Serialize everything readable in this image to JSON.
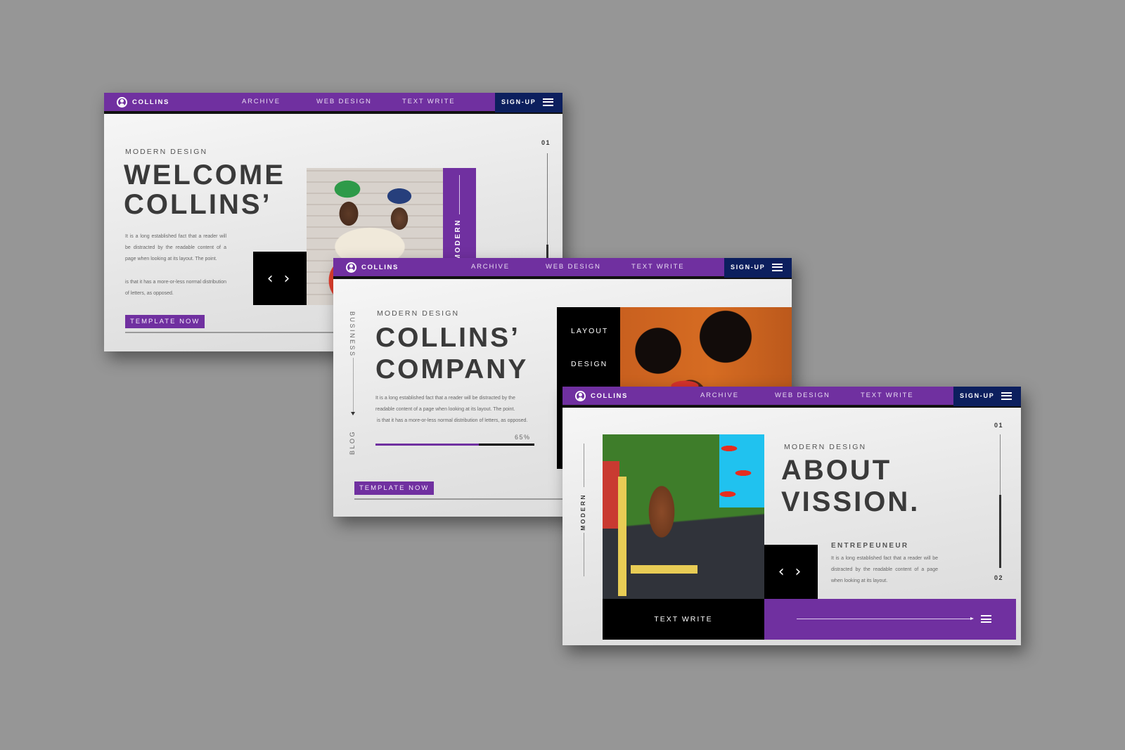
{
  "colors": {
    "brand_purple": "#7030a0",
    "signup_navy": "#0c1f5e",
    "headline_gray": "#3a3a3a",
    "background": "#969696"
  },
  "nav": {
    "brand_icon": "user-circle-icon",
    "brand_label": "COLLINS",
    "links": [
      "ARCHIVE",
      "WEB DESIGN",
      "TEXT WRITE"
    ],
    "signup_label": "SIGN-UP",
    "menu_icon": "hamburger-menu-icon"
  },
  "slides": [
    {
      "eyebrow": "MODERN DESIGN",
      "headline_line1": "WELCOME",
      "headline_line2": "COLLINS’",
      "body_paragraph1": "It is a long established fact that a reader will be distracted by the readable content of a page when looking at its layout. The point.",
      "body_paragraph2": "is that it has a more-or-less normal distribution of letters, as opposed.",
      "arrows_icon": "chevron-left-right-icon",
      "arrows_glyph": "‹ ›",
      "side_tag": "MODERN",
      "counter": "01",
      "progress_fraction": 0.35,
      "cta_label": "TEMPLATE NOW",
      "photo": "two men reading newspaper photo"
    },
    {
      "eyebrow": "MODERN DESIGN",
      "headline_line1": "COLLINS’",
      "headline_line2": "COMPANY",
      "body_line1": "It is a long established fact that a reader will be distracted by the",
      "body_line2": "readable content of a page when looking at its layout. The point.",
      "body_line3": "is that it has a more-or-less normal distribution of letters, as opposed.",
      "side_top_label": "BUSINESS",
      "side_bottom_label": "BLOG",
      "progress_label": "65%",
      "progress_fraction": 0.65,
      "panel_label1": "LAYOUT",
      "panel_label2": "DESIGN",
      "cta_label": "TEMPLATE NOW",
      "photo": "woman with red sunglasses photo"
    },
    {
      "eyebrow": "MODERN DESIGN",
      "headline_line1": "ABOUT",
      "headline_line2": "VISSION.",
      "side_label": "MODERN",
      "subheading": "ENTREPEUNEUR",
      "body_text": "It is a long established fact that a reader will be distracted by the readable content of a page when looking at its layout.",
      "arrows_icon": "chevron-left-right-icon",
      "arrows_glyph": "‹ ›",
      "text_write_label": "TEXT WRITE",
      "counter_top": "01",
      "counter_bottom": "02",
      "progress_fraction": 0.55,
      "arrow_icon": "long-arrow-right-icon",
      "menu_icon": "hamburger-menu-icon",
      "photo": "woman with body paint on yellow chair photo"
    }
  ]
}
